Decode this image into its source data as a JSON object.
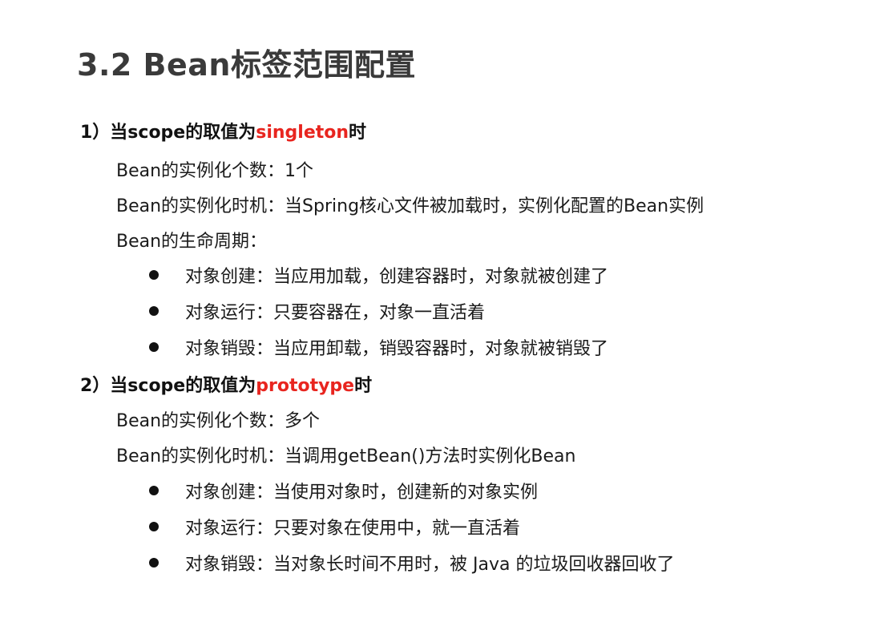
{
  "title": "3.2 Bean标签范围配置",
  "section1": {
    "heading_prefix": "1）当scope的取值为",
    "heading_keyword": "singleton",
    "heading_suffix": "时",
    "lines": [
      "Bean的实例化个数：1个",
      "Bean的实例化时机：当Spring核心文件被加载时，实例化配置的Bean实例",
      "Bean的生命周期："
    ],
    "bullets": [
      "对象创建：当应用加载，创建容器时，对象就被创建了",
      "对象运行：只要容器在，对象一直活着",
      "对象销毁：当应用卸载，销毁容器时，对象就被销毁了"
    ]
  },
  "section2": {
    "heading_prefix": "2）当scope的取值为",
    "heading_keyword": "prototype",
    "heading_suffix": "时",
    "lines": [
      "Bean的实例化个数：多个",
      "Bean的实例化时机：当调用getBean()方法时实例化Bean"
    ],
    "bullets": [
      "对象创建：当使用对象时，创建新的对象实例",
      "对象运行：只要对象在使用中，就一直活着",
      "对象销毁：当对象长时间不用时，被 Java 的垃圾回收器回收了"
    ]
  },
  "colors": {
    "keyword": "#e8251f",
    "title": "#3a3a3a",
    "text": "#1a1a1a"
  }
}
